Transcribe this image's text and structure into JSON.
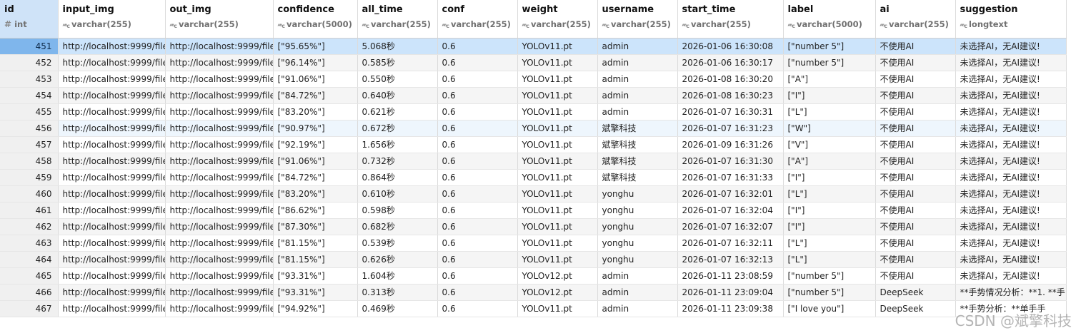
{
  "columns": [
    {
      "name": "id",
      "type": "int",
      "icon": "#"
    },
    {
      "name": "input_img",
      "type": "varchar(255)",
      "icon": "ABC"
    },
    {
      "name": "out_img",
      "type": "varchar(255)",
      "icon": "ABC"
    },
    {
      "name": "confidence",
      "type": "varchar(5000)",
      "icon": "ABC"
    },
    {
      "name": "all_time",
      "type": "varchar(255)",
      "icon": "ABC"
    },
    {
      "name": "conf",
      "type": "varchar(255)",
      "icon": "ABC"
    },
    {
      "name": "weight",
      "type": "varchar(255)",
      "icon": "ABC"
    },
    {
      "name": "username",
      "type": "varchar(255)",
      "icon": "ABC"
    },
    {
      "name": "start_time",
      "type": "varchar(255)",
      "icon": "ABC"
    },
    {
      "name": "label",
      "type": "varchar(5000)",
      "icon": "ABC"
    },
    {
      "name": "ai",
      "type": "varchar(255)",
      "icon": "ABC"
    },
    {
      "name": "suggestion",
      "type": "longtext",
      "icon": "ABC"
    }
  ],
  "rows": [
    [
      "451",
      "http://localhost:9999/file",
      "http://localhost:9999/file",
      "[\"95.65%\"]",
      "5.068秒",
      "0.6",
      "YOLOv11.pt",
      "admin",
      "2026-01-06 16:30:08",
      "[\"number 5\"]",
      "不使用AI",
      "未选择AI，无AI建议!"
    ],
    [
      "452",
      "http://localhost:9999/file",
      "http://localhost:9999/file",
      "[\"96.14%\"]",
      "0.585秒",
      "0.6",
      "YOLOv11.pt",
      "admin",
      "2026-01-06 16:30:17",
      "[\"number 5\"]",
      "不使用AI",
      "未选择AI，无AI建议!"
    ],
    [
      "453",
      "http://localhost:9999/file",
      "http://localhost:9999/file",
      "[\"91.06%\"]",
      "0.550秒",
      "0.6",
      "YOLOv11.pt",
      "admin",
      "2026-01-08 16:30:20",
      "[\"A\"]",
      "不使用AI",
      "未选择AI，无AI建议!"
    ],
    [
      "454",
      "http://localhost:9999/file",
      "http://localhost:9999/file",
      "[\"84.72%\"]",
      "0.640秒",
      "0.6",
      "YOLOv11.pt",
      "admin",
      "2026-01-08 16:30:23",
      "[\"I\"]",
      "不使用AI",
      "未选择AI，无AI建议!"
    ],
    [
      "455",
      "http://localhost:9999/file",
      "http://localhost:9999/file",
      "[\"83.20%\"]",
      "0.621秒",
      "0.6",
      "YOLOv11.pt",
      "admin",
      "2026-01-07 16:30:31",
      "[\"L\"]",
      "不使用AI",
      "未选择AI，无AI建议!"
    ],
    [
      "456",
      "http://localhost:9999/file",
      "http://localhost:9999/file",
      "[\"90.97%\"]",
      "0.672秒",
      "0.6",
      "YOLOv11.pt",
      "斌擎科技",
      "2026-01-07 16:31:23",
      "[\"W\"]",
      "不使用AI",
      "未选择AI，无AI建议!"
    ],
    [
      "457",
      "http://localhost:9999/file",
      "http://localhost:9999/file",
      "[\"92.19%\"]",
      "1.656秒",
      "0.6",
      "YOLOv11.pt",
      "斌擎科技",
      "2026-01-09 16:31:26",
      "[\"V\"]",
      "不使用AI",
      "未选择AI，无AI建议!"
    ],
    [
      "458",
      "http://localhost:9999/file",
      "http://localhost:9999/file",
      "[\"91.06%\"]",
      "0.732秒",
      "0.6",
      "YOLOv11.pt",
      "斌擎科技",
      "2026-01-07 16:31:30",
      "[\"A\"]",
      "不使用AI",
      "未选择AI，无AI建议!"
    ],
    [
      "459",
      "http://localhost:9999/file",
      "http://localhost:9999/file",
      "[\"84.72%\"]",
      "0.864秒",
      "0.6",
      "YOLOv11.pt",
      "斌擎科技",
      "2026-01-07 16:31:33",
      "[\"I\"]",
      "不使用AI",
      "未选择AI，无AI建议!"
    ],
    [
      "460",
      "http://localhost:9999/file",
      "http://localhost:9999/file",
      "[\"83.20%\"]",
      "0.610秒",
      "0.6",
      "YOLOv11.pt",
      "yonghu",
      "2026-01-07 16:32:01",
      "[\"L\"]",
      "不使用AI",
      "未选择AI，无AI建议!"
    ],
    [
      "461",
      "http://localhost:9999/file",
      "http://localhost:9999/file",
      "[\"86.62%\"]",
      "0.598秒",
      "0.6",
      "YOLOv11.pt",
      "yonghu",
      "2026-01-07 16:32:04",
      "[\"I\"]",
      "不使用AI",
      "未选择AI，无AI建议!"
    ],
    [
      "462",
      "http://localhost:9999/file",
      "http://localhost:9999/file",
      "[\"87.30%\"]",
      "0.682秒",
      "0.6",
      "YOLOv11.pt",
      "yonghu",
      "2026-01-07 16:32:07",
      "[\"I\"]",
      "不使用AI",
      "未选择AI，无AI建议!"
    ],
    [
      "463",
      "http://localhost:9999/file",
      "http://localhost:9999/file",
      "[\"81.15%\"]",
      "0.539秒",
      "0.6",
      "YOLOv11.pt",
      "yonghu",
      "2026-01-07 16:32:11",
      "[\"L\"]",
      "不使用AI",
      "未选择AI，无AI建议!"
    ],
    [
      "464",
      "http://localhost:9999/file",
      "http://localhost:9999/file",
      "[\"81.15%\"]",
      "0.626秒",
      "0.6",
      "YOLOv11.pt",
      "yonghu",
      "2026-01-07 16:32:13",
      "[\"L\"]",
      "不使用AI",
      "未选择AI，无AI建议!"
    ],
    [
      "465",
      "http://localhost:9999/file",
      "http://localhost:9999/file",
      "[\"93.31%\"]",
      "1.604秒",
      "0.6",
      "YOLOv12.pt",
      "admin",
      "2026-01-11 23:08:59",
      "[\"number 5\"]",
      "不使用AI",
      "未选择AI，无AI建议!"
    ],
    [
      "466",
      "http://localhost:9999/file",
      "http://localhost:9999/file",
      "[\"93.31%\"]",
      "0.313秒",
      "0.6",
      "YOLOv12.pt",
      "admin",
      "2026-01-11 23:09:04",
      "[\"number 5\"]",
      "DeepSeek",
      "**手势情况分析：**1. **手"
    ],
    [
      "467",
      "http://localhost:9999/file",
      "http://localhost:9999/file",
      "[\"94.92%\"]",
      "0.469秒",
      "0.6",
      "YOLOv11.pt",
      "admin",
      "2026-01-11 23:09:38",
      "[\"I love you\"]",
      "DeepSeek",
      "**手势分析：**单手手"
    ]
  ],
  "selected_row": 0,
  "hover_row": 5,
  "watermark": "CSDN @斌擎科技"
}
